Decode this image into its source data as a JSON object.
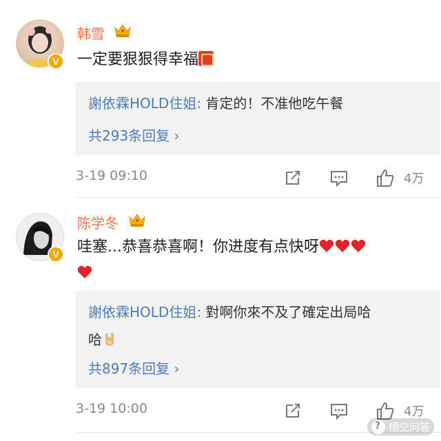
{
  "comments": [
    {
      "username": "韩雪",
      "text": "一定要狠狠得幸福",
      "reply_author": "謝依霖HOLD住姐:",
      "reply_text": "肯定的！不准他吃午餐",
      "more_replies": "共293条回复 ›",
      "timestamp": "3-19 09:10",
      "likes": "4万"
    },
    {
      "username": "陈学冬",
      "text": "哇塞...恭喜恭喜啊！你进度有点快呀",
      "reply_author": "謝依霖HOLD住姐:",
      "reply_text_line1": "對啊你來不及了確定出局哈",
      "reply_text_line2": "哈",
      "more_replies": "共897条回复 ›",
      "timestamp": "3-19 10:00",
      "likes": "4万"
    }
  ],
  "watermark": "悟空问答",
  "colors": {
    "username": "#eb7350",
    "link": "#4e7cb1",
    "heart": "#e0242a",
    "crown": "#f2b300",
    "reply_bg": "#f2f2f2"
  },
  "icons": [
    "crown-icon",
    "verified-badge-icon",
    "repost-icon",
    "comment-icon",
    "like-icon",
    "heart-icon",
    "double-happiness-icon",
    "rock-hand-icon"
  ]
}
